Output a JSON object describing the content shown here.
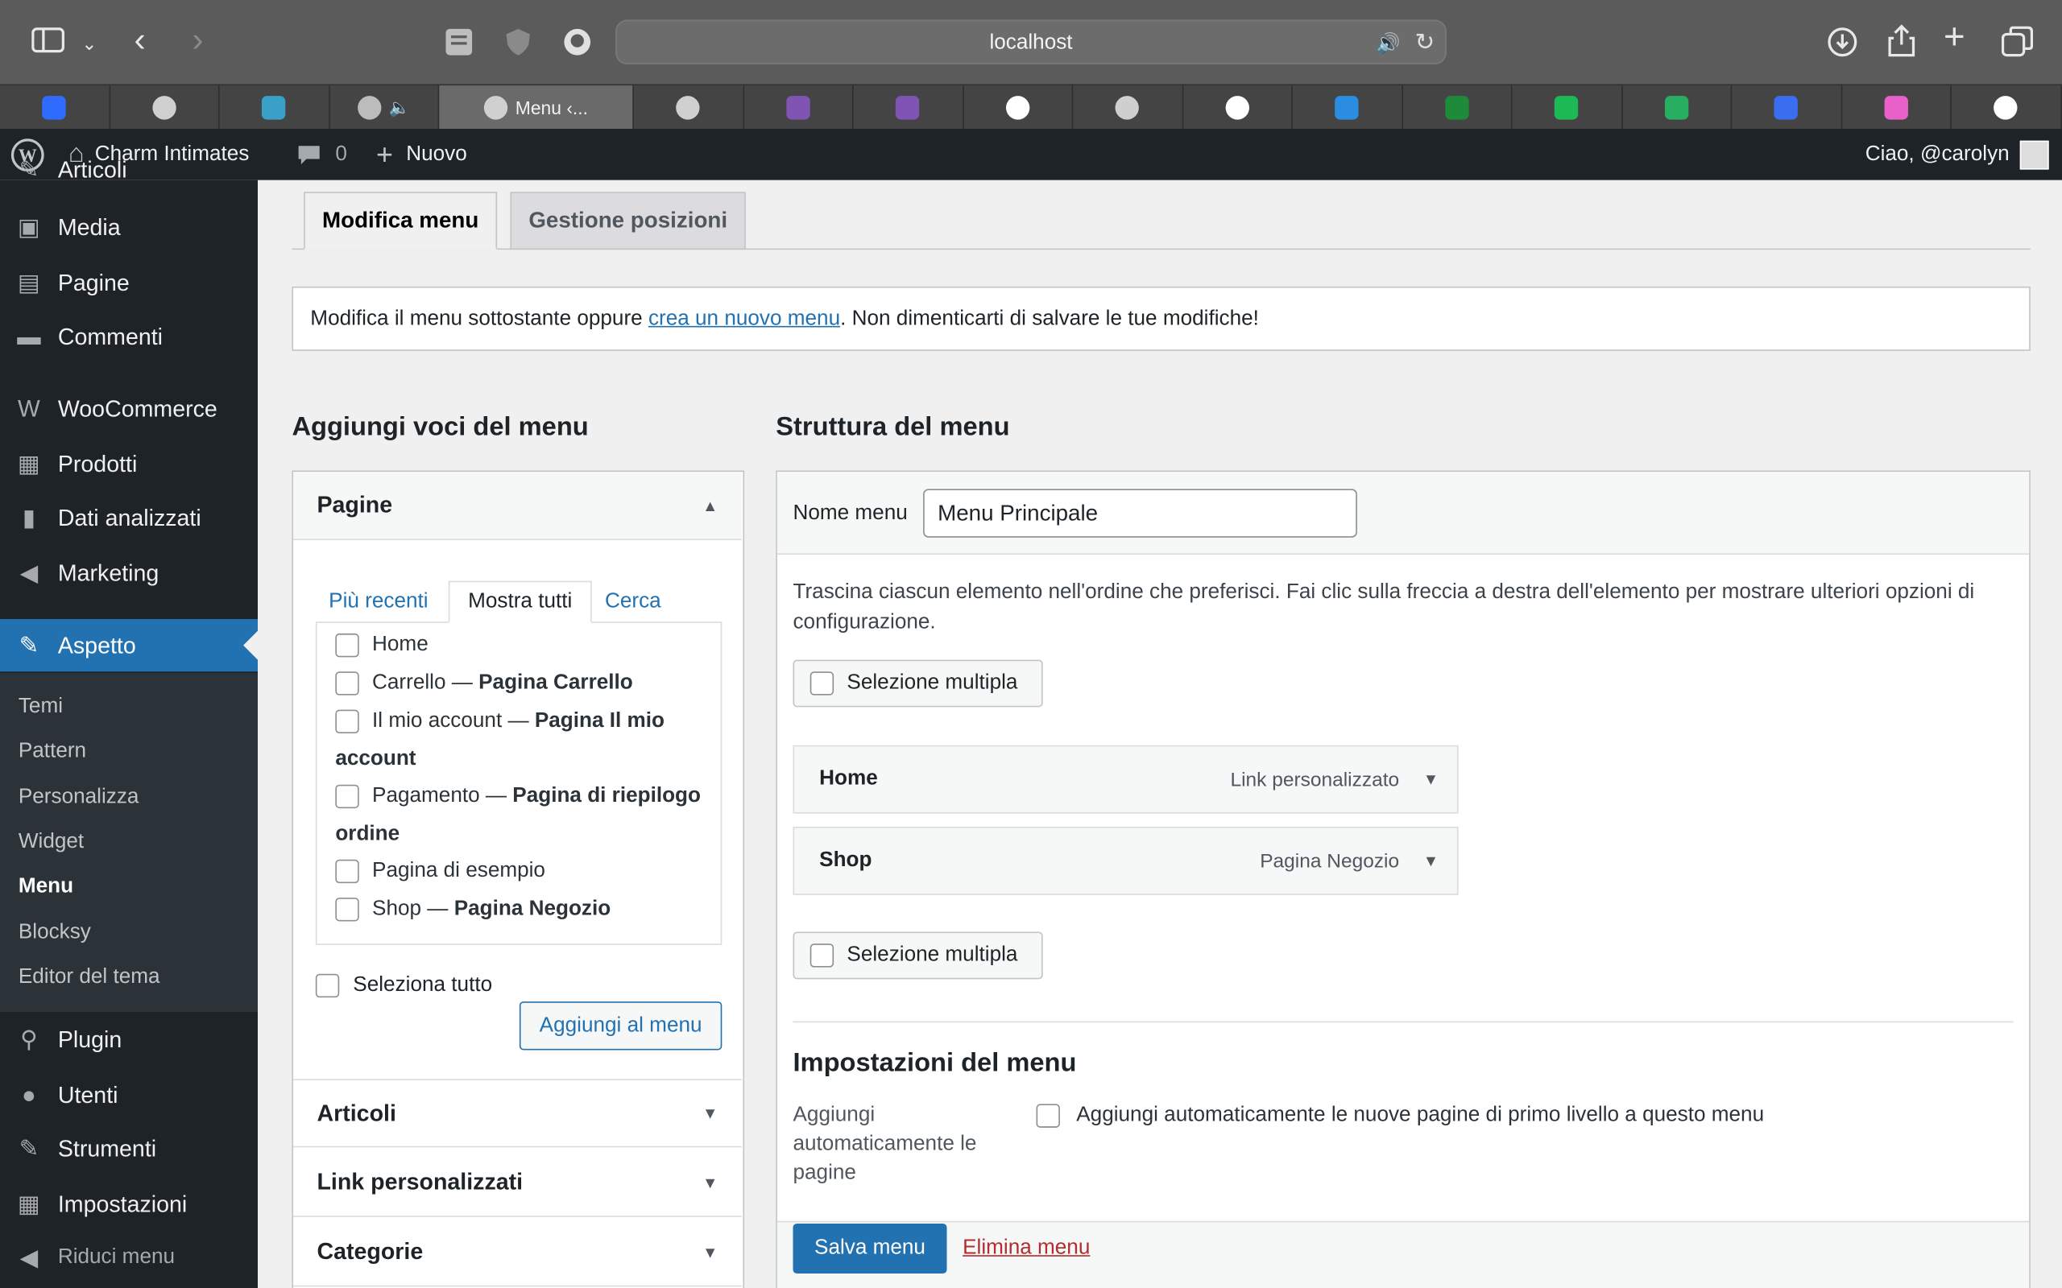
{
  "browser": {
    "url": "localhost",
    "active_tab_title": "Menu ‹...",
    "tabs": [
      {
        "icon": "webflow-icon",
        "color": "#2f6bff"
      },
      {
        "icon": "elephant-icon",
        "color": "#d0d0d0"
      },
      {
        "icon": "bolt-icon",
        "color": "#3aa0c8"
      },
      {
        "icon": "wordpress-icon",
        "color": "#bcbcbc"
      },
      {
        "icon": "elephant-icon",
        "color": "#d0d0d0"
      },
      {
        "icon": "elephant-icon",
        "color": "#d0d0d0"
      },
      {
        "icon": "woo-icon",
        "color": "#7f54b3"
      },
      {
        "icon": "woo-icon",
        "color": "#7f54b3"
      },
      {
        "icon": "google-icon",
        "color": "#ffffff"
      },
      {
        "icon": "clock-icon",
        "color": "#cfcfcf"
      },
      {
        "icon": "openai-icon",
        "color": "#ffffff"
      },
      {
        "icon": "edge-icon",
        "color": "#2a8de0"
      },
      {
        "icon": "w-icon",
        "color": "#1f8a3a"
      },
      {
        "icon": "p-icon",
        "color": "#1db954"
      },
      {
        "icon": "e-icon",
        "color": "#27ae60"
      },
      {
        "icon": "f-icon",
        "color": "#3b6df0"
      },
      {
        "icon": "elementor-icon",
        "color": "#e860c9"
      },
      {
        "icon": "openai-icon",
        "color": "#ffffff"
      }
    ]
  },
  "adminbar": {
    "site_name": "Charm Intimates",
    "comments_count": "0",
    "new_label": "Nuovo",
    "greeting": "Ciao, @carolyn"
  },
  "sidebar": {
    "partial_top": "Articoli",
    "items": [
      {
        "label": "Media",
        "icon": "media-icon"
      },
      {
        "label": "Pagine",
        "icon": "pages-icon"
      },
      {
        "label": "Commenti",
        "icon": "comments-icon"
      },
      {
        "label": "WooCommerce",
        "icon": "woo-icon"
      },
      {
        "label": "Prodotti",
        "icon": "products-icon"
      },
      {
        "label": "Dati analizzati",
        "icon": "analytics-icon"
      },
      {
        "label": "Marketing",
        "icon": "megaphone-icon"
      },
      {
        "label": "Aspetto",
        "icon": "brush-icon"
      }
    ],
    "submenu": [
      "Temi",
      "Pattern",
      "Personalizza",
      "Widget",
      "Menu",
      "Blocksy",
      "Editor del tema"
    ],
    "bottom_items": [
      {
        "label": "Plugin",
        "icon": "plugin-icon"
      },
      {
        "label": "Utenti",
        "icon": "user-icon"
      },
      {
        "label": "Strumenti",
        "icon": "wrench-icon"
      },
      {
        "label": "Impostazioni",
        "icon": "settings-icon"
      }
    ],
    "collapse_label": "Riduci menu"
  },
  "tabs": {
    "edit": "Modifica menu",
    "locations": "Gestione posizioni"
  },
  "notice": {
    "before": "Modifica il menu sottostante oppure ",
    "link": "crea un nuovo menu",
    "after": ". Non dimenticarti di salvare le tue modifiche!"
  },
  "add_items": {
    "heading": "Aggiungi voci del menu",
    "pages_heading": "Pagine",
    "subtabs": [
      "Più recenti",
      "Mostra tutti",
      "Cerca"
    ],
    "pages": [
      {
        "name": "Home",
        "suffix": ""
      },
      {
        "name": "Carrello — ",
        "suffix": "Pagina Carrello"
      },
      {
        "name": "Il mio account — ",
        "suffix": "Pagina Il mio account"
      },
      {
        "name": "Pagamento — ",
        "suffix": "Pagina di riepilogo ordine"
      },
      {
        "name": "Pagina di esempio",
        "suffix": ""
      },
      {
        "name": "Shop — ",
        "suffix": "Pagina Negozio"
      }
    ],
    "select_all": "Seleziona tutto",
    "add_button": "Aggiungi al menu",
    "sections": [
      "Articoli",
      "Link personalizzati",
      "Categorie"
    ]
  },
  "structure": {
    "heading": "Struttura del menu",
    "name_label": "Nome menu",
    "name_value": "Menu Principale",
    "instructions": "Trascina ciascun elemento nell'ordine che preferisci. Fai clic sulla freccia a destra dell'elemento per mostrare ulteriori opzioni di configurazione.",
    "bulk_select": "Selezione multipla",
    "items": [
      {
        "title": "Home",
        "type": "Link personalizzato"
      },
      {
        "title": "Shop",
        "type": "Pagina Negozio"
      }
    ],
    "settings_heading": "Impostazioni del menu",
    "auto_add_label": "Aggiungi automaticamente le pagine",
    "auto_add_text": "Aggiungi automaticamente le nuove pagine di primo livello a questo menu",
    "save_button": "Salva menu",
    "delete_link": "Elimina menu"
  }
}
